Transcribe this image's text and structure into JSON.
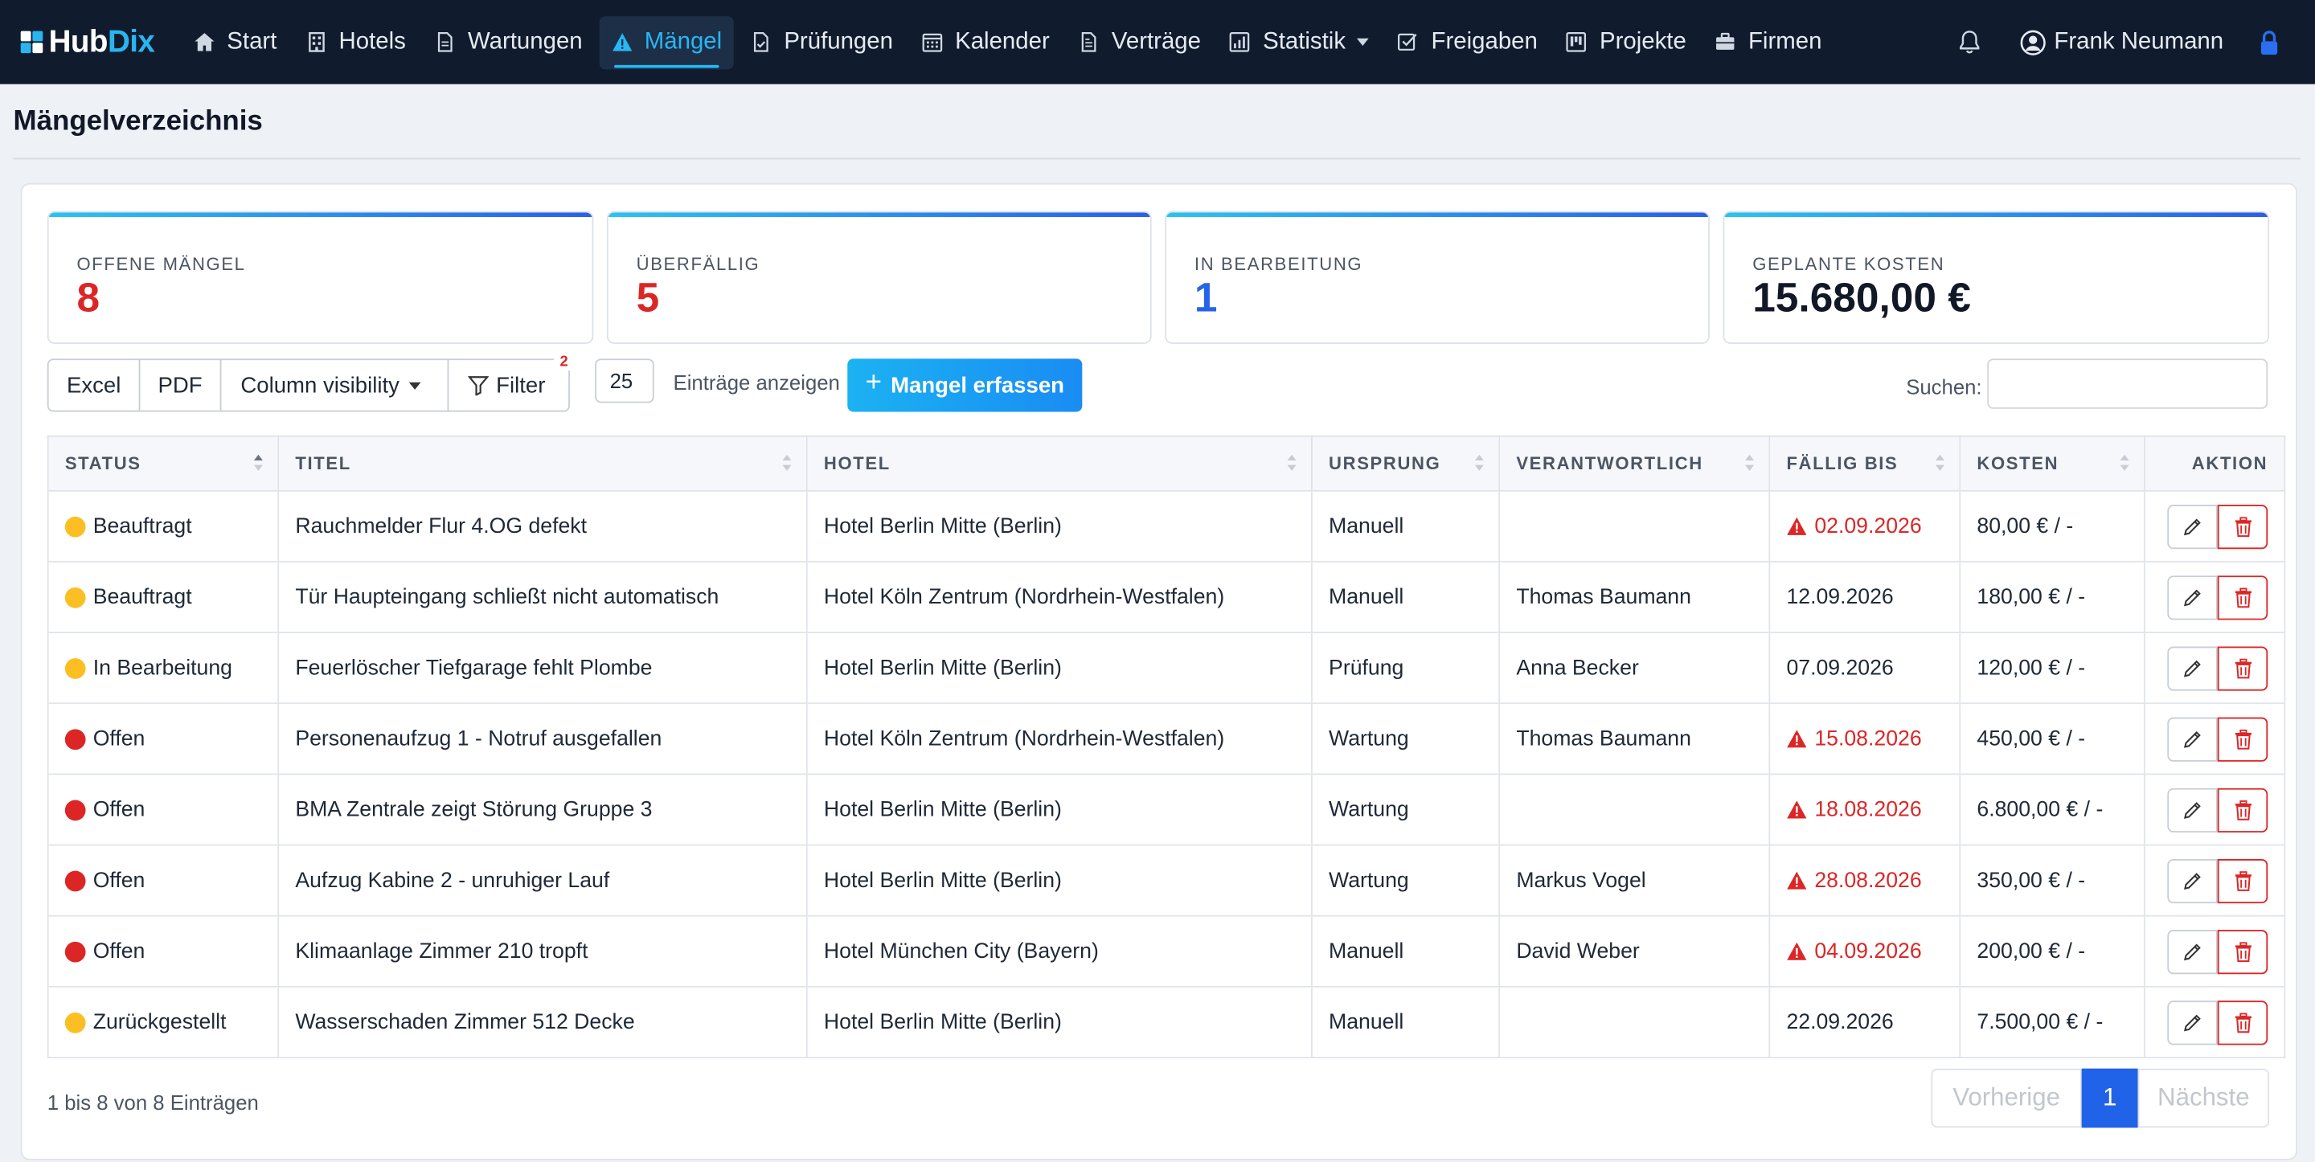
{
  "brand": {
    "part1": "Hub",
    "part2": "Dix"
  },
  "nav": {
    "items": [
      {
        "label": "Start",
        "icon": "home-icon"
      },
      {
        "label": "Hotels",
        "icon": "building-icon"
      },
      {
        "label": "Wartungen",
        "icon": "document-icon"
      },
      {
        "label": "Mängel",
        "icon": "warning-icon",
        "active": true
      },
      {
        "label": "Prüfungen",
        "icon": "check-document-icon"
      },
      {
        "label": "Kalender",
        "icon": "calendar-icon"
      },
      {
        "label": "Verträge",
        "icon": "contract-icon"
      },
      {
        "label": "Statistik",
        "icon": "chart-icon",
        "dropdown": true
      },
      {
        "label": "Freigaben",
        "icon": "checkbox-icon"
      },
      {
        "label": "Projekte",
        "icon": "kanban-icon"
      },
      {
        "label": "Firmen",
        "icon": "briefcase-icon"
      }
    ],
    "user": "Frank Neumann"
  },
  "page": {
    "title": "Mängelverzeichnis"
  },
  "stats": [
    {
      "label": "Offene Mängel",
      "value": "8",
      "color": "#dc2626"
    },
    {
      "label": "Überfällig",
      "value": "5",
      "color": "#dc2626"
    },
    {
      "label": "In Bearbeitung",
      "value": "1",
      "color": "#2563eb"
    },
    {
      "label": "Geplante Kosten",
      "value": "15.680,00 €",
      "color": "#111827"
    }
  ],
  "toolbar": {
    "excel": "Excel",
    "pdf": "PDF",
    "colvis": "Column visibility",
    "filter": "Filter",
    "filter_badge": "2",
    "length": "25",
    "length_label": "Einträge anzeigen",
    "add": "Mangel erfassen",
    "search_label": "Suchen:",
    "search_value": ""
  },
  "table": {
    "headers": [
      "Status",
      "Titel",
      "Hotel",
      "Ursprung",
      "Verantwortlich",
      "Fällig bis",
      "Kosten",
      "Aktion"
    ],
    "status_colors": {
      "Beauftragt": "#fbbf24",
      "In Bearbeitung": "#fbbf24",
      "Offen": "#dc2626",
      "Zurückgestellt": "#fbbf24"
    },
    "rows": [
      {
        "status": "Beauftragt",
        "titel": "Rauchmelder Flur 4.OG defekt",
        "hotel": "Hotel Berlin Mitte (Berlin)",
        "ursprung": "Manuell",
        "verantwortlich": "",
        "faellig": "02.09.2026",
        "overdue": true,
        "kosten": "80,00 € / -"
      },
      {
        "status": "Beauftragt",
        "titel": "Tür Haupteingang schließt nicht automatisch",
        "hotel": "Hotel Köln Zentrum (Nordrhein-Westfalen)",
        "ursprung": "Manuell",
        "verantwortlich": "Thomas Baumann",
        "faellig": "12.09.2026",
        "overdue": false,
        "kosten": "180,00 € / -"
      },
      {
        "status": "In Bearbeitung",
        "titel": "Feuerlöscher Tiefgarage fehlt Plombe",
        "hotel": "Hotel Berlin Mitte (Berlin)",
        "ursprung": "Prüfung",
        "verantwortlich": "Anna Becker",
        "faellig": "07.09.2026",
        "overdue": false,
        "kosten": "120,00 € / -"
      },
      {
        "status": "Offen",
        "titel": "Personenaufzug 1 - Notruf ausgefallen",
        "hotel": "Hotel Köln Zentrum (Nordrhein-Westfalen)",
        "ursprung": "Wartung",
        "verantwortlich": "Thomas Baumann",
        "faellig": "15.08.2026",
        "overdue": true,
        "kosten": "450,00 € / -"
      },
      {
        "status": "Offen",
        "titel": "BMA Zentrale zeigt Störung Gruppe 3",
        "hotel": "Hotel Berlin Mitte (Berlin)",
        "ursprung": "Wartung",
        "verantwortlich": "",
        "faellig": "18.08.2026",
        "overdue": true,
        "kosten": "6.800,00 € / -"
      },
      {
        "status": "Offen",
        "titel": "Aufzug Kabine 2 - unruhiger Lauf",
        "hotel": "Hotel Berlin Mitte (Berlin)",
        "ursprung": "Wartung",
        "verantwortlich": "Markus Vogel",
        "faellig": "28.08.2026",
        "overdue": true,
        "kosten": "350,00 € / -"
      },
      {
        "status": "Offen",
        "titel": "Klimaanlage Zimmer 210 tropft",
        "hotel": "Hotel München City (Bayern)",
        "ursprung": "Manuell",
        "verantwortlich": "David Weber",
        "faellig": "04.09.2026",
        "overdue": true,
        "kosten": "200,00 € / -"
      },
      {
        "status": "Zurückgestellt",
        "titel": "Wasserschaden Zimmer 512 Decke",
        "hotel": "Hotel Berlin Mitte (Berlin)",
        "ursprung": "Manuell",
        "verantwortlich": "",
        "faellig": "22.09.2026",
        "overdue": false,
        "kosten": "7.500,00 € / -"
      }
    ]
  },
  "footer": {
    "info": "1 bis 8 von 8 Einträgen",
    "prev": "Vorherige",
    "page": "1",
    "next": "Nächste"
  },
  "colors": {
    "accent": "#27b7f5",
    "danger": "#dc2626",
    "primary": "#2163e8"
  }
}
